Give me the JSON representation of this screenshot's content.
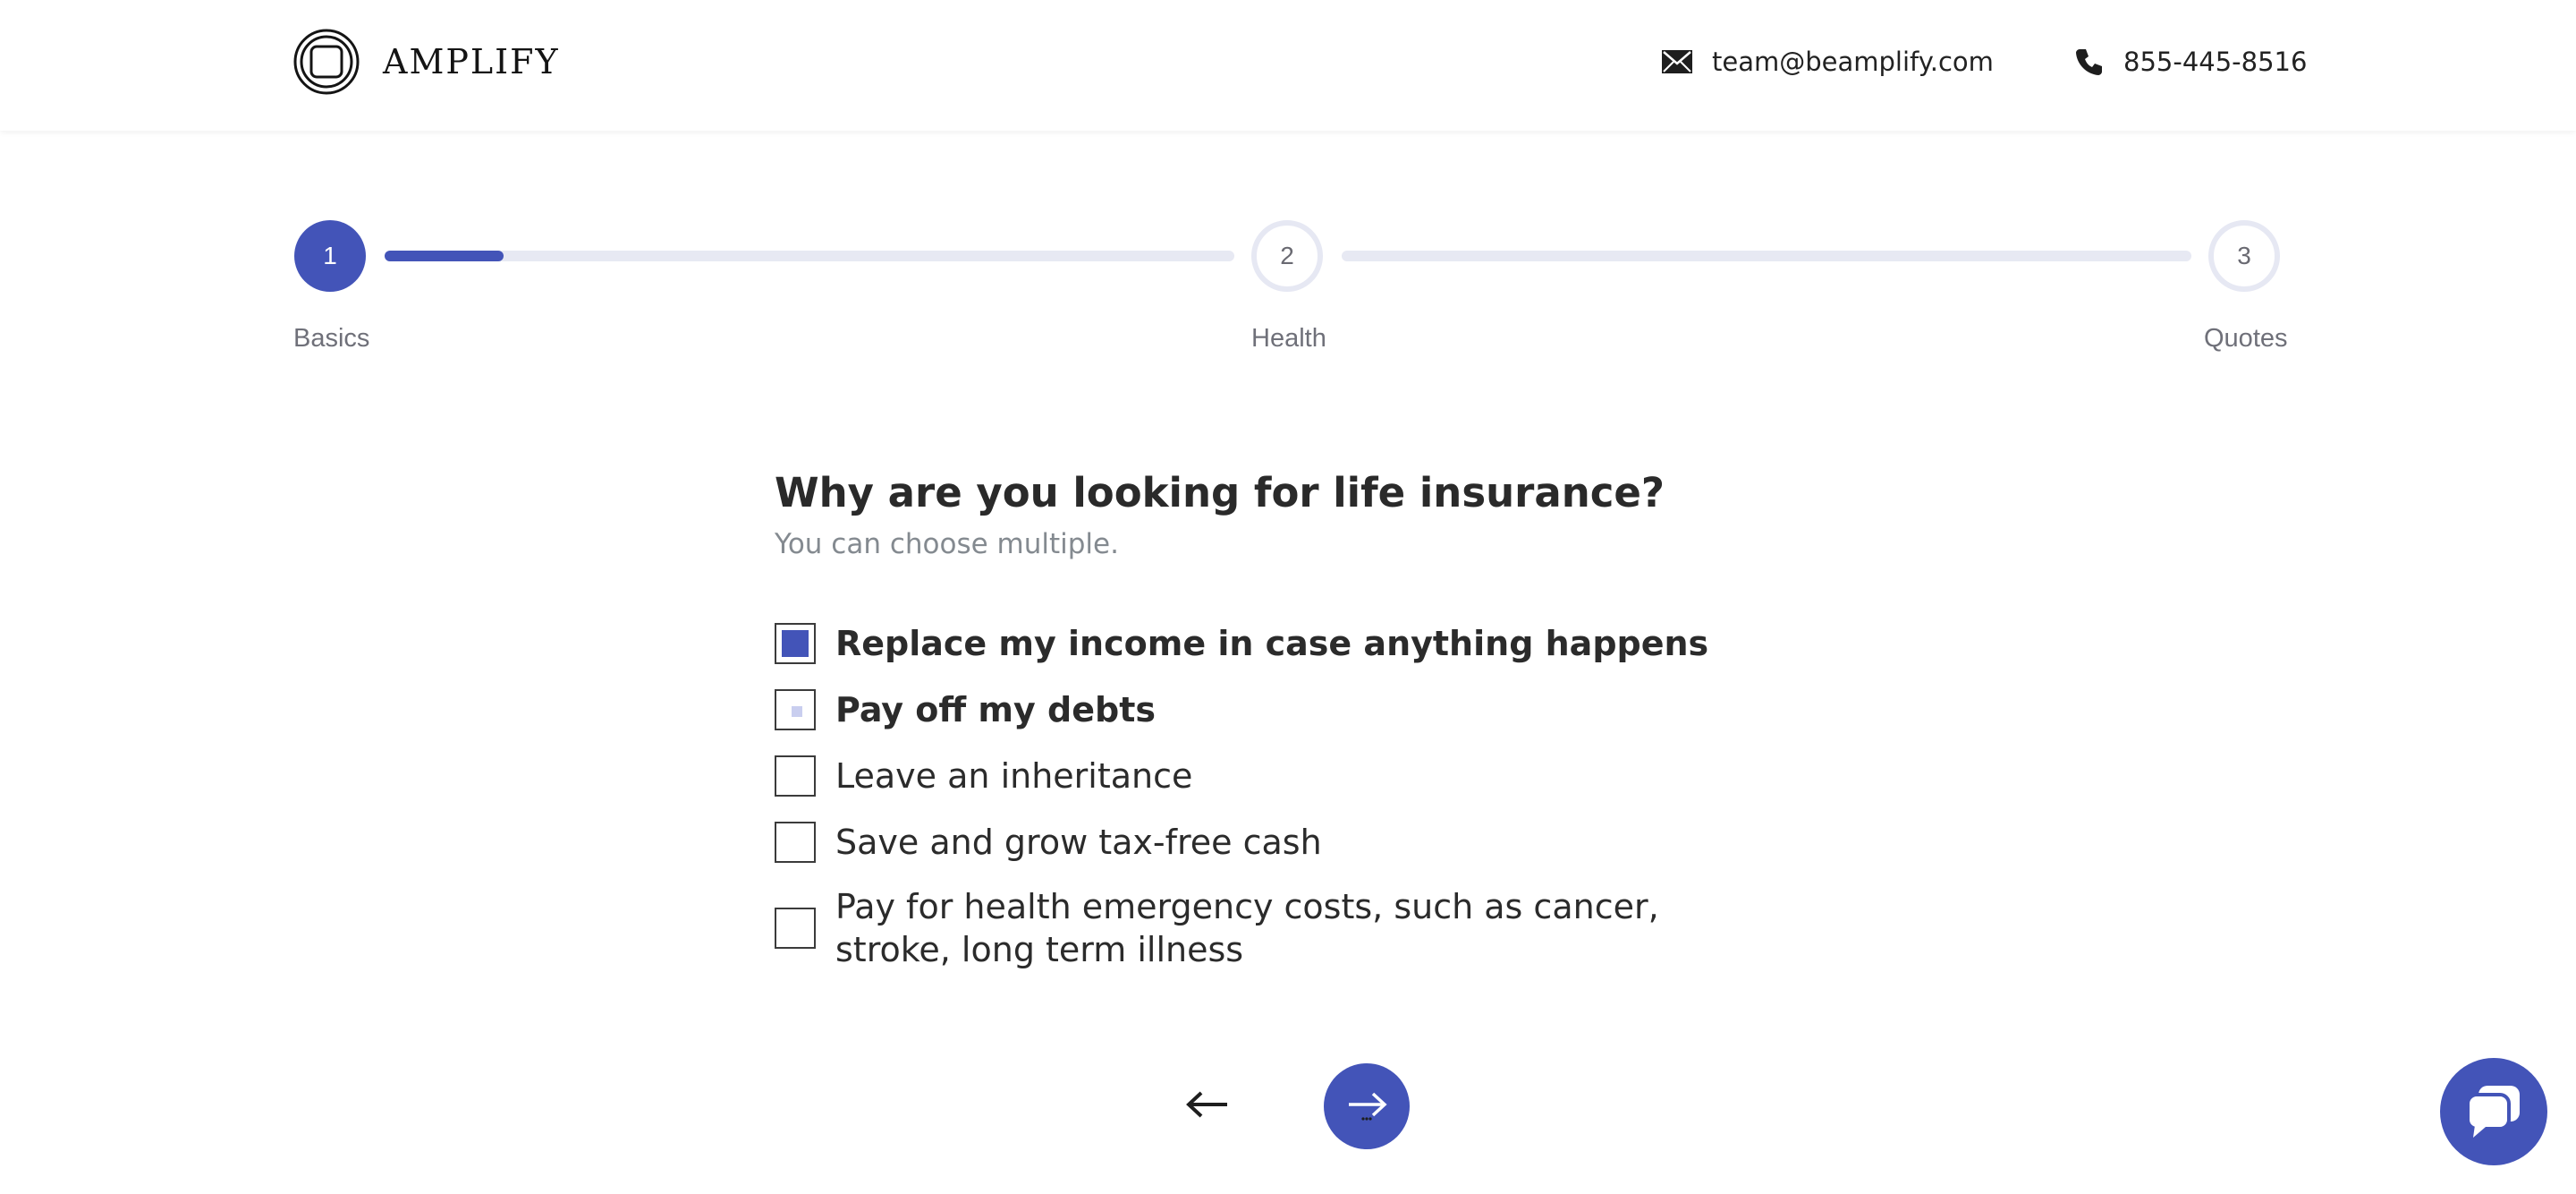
{
  "brand": {
    "name": "AMPLIFY"
  },
  "contact": {
    "email": "team@beamplify.com",
    "phone": "855-445-8516"
  },
  "progress": {
    "current_step": 1,
    "current_step_fill": 0.14,
    "steps": [
      {
        "number": "1",
        "label": "Basics"
      },
      {
        "number": "2",
        "label": "Health"
      },
      {
        "number": "3",
        "label": "Quotes"
      }
    ]
  },
  "question": {
    "title": "Why are you looking for life insurance?",
    "subtitle": "You can choose multiple."
  },
  "options": [
    {
      "label": "Replace my income in case anything happens",
      "state": "checked"
    },
    {
      "label": "Pay off my debts",
      "state": "hover"
    },
    {
      "label": "Leave an inheritance",
      "state": "unchecked"
    },
    {
      "label": "Save and grow tax-free cash",
      "state": "unchecked"
    },
    {
      "label": "Pay for health emergency costs, such as cancer, stroke, long term illness",
      "state": "unchecked"
    }
  ],
  "colors": {
    "accent": "#4354b8",
    "track": "#e7e9f3",
    "muted_text": "#848a90"
  },
  "icons": {
    "email": "envelope-icon",
    "phone": "phone-icon",
    "back": "arrow-left-icon",
    "next": "arrow-right-icon",
    "chat": "chat-bubble-icon"
  }
}
